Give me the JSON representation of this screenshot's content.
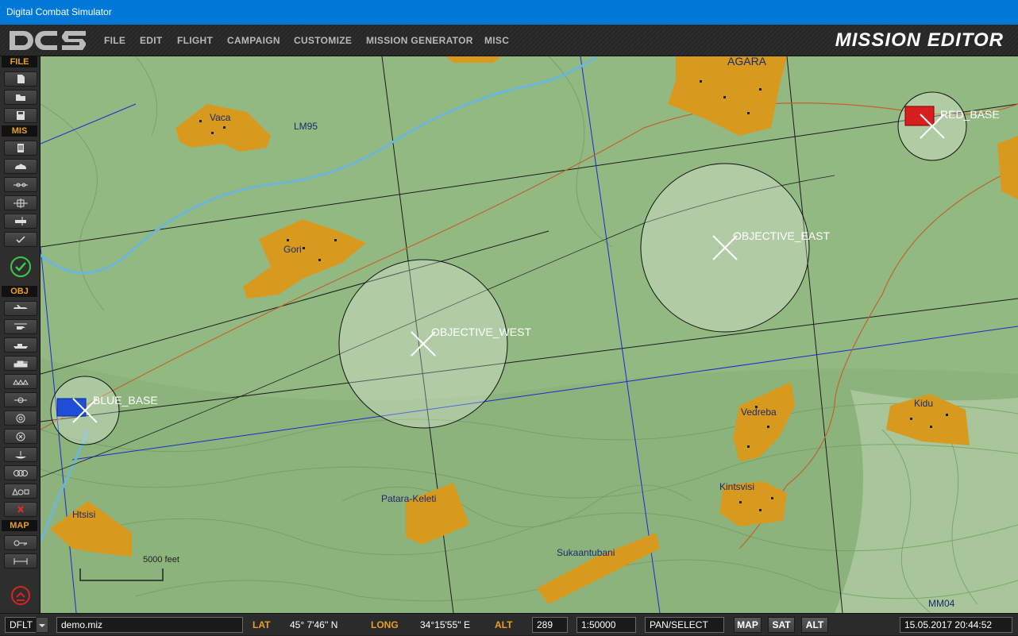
{
  "window": {
    "title": "Digital Combat Simulator"
  },
  "menu": {
    "items": [
      "FILE",
      "EDIT",
      "FLIGHT",
      "CAMPAIGN",
      "CUSTOMIZE",
      "MISSION GENERATOR",
      "MISC"
    ],
    "section_title": "MISSION EDITOR"
  },
  "toolbar": {
    "sections": {
      "file": "FILE",
      "mis": "MIS",
      "obj": "OBJ",
      "map": "MAP"
    }
  },
  "map": {
    "towns": [
      "Vaca",
      "Gori",
      "AGARA",
      "Vedreba",
      "Kidu",
      "Kintsvisi",
      "Htsisi",
      "Patara-Keleti",
      "Sukaantubani"
    ],
    "grid_labels": [
      "LM95",
      "MM04"
    ],
    "units": {
      "blue_base": "BLUE_BASE",
      "red_base": "RED_BASE",
      "objective_west": "OBJECTIVE_WEST",
      "objective_east": "OBJECTIVE_EAST"
    },
    "scale_label": "5000 feet",
    "colors": {
      "terrain": "#93b983",
      "town": "#d89a1e",
      "blue_unit": "#1f4fd8",
      "red_unit": "#d81f1f",
      "river": "#6cb6d6",
      "road": "#c0642a"
    }
  },
  "status": {
    "layer": "DFLT",
    "filename": "demo.miz",
    "lat_label": "LAT",
    "lat_value": "45° 7'46'' N",
    "long_label": "LONG",
    "long_value": "34°15'55'' E",
    "alt_label": "ALT",
    "alt_value": "289",
    "scale": "1:50000",
    "mode": "PAN/SELECT",
    "map_btn": "MAP",
    "sat_btn": "SAT",
    "alt_btn": "ALT",
    "datetime": "15.05.2017 20:44:52"
  }
}
